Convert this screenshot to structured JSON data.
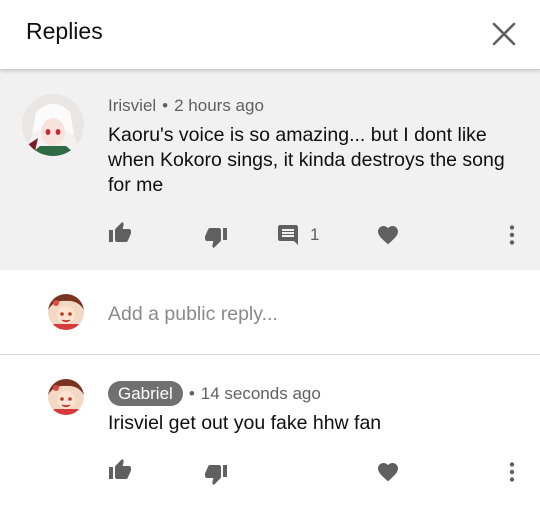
{
  "header": {
    "title": "Replies",
    "close_icon": "close-icon"
  },
  "parent_comment": {
    "author": "Irisviel",
    "separator": "•",
    "time": "2 hours ago",
    "text": "Kaoru's voice is so amazing... but I dont like when Kokoro sings, it kinda destroys the song for me",
    "reply_count": "1",
    "icons": [
      "like-icon",
      "dislike-icon",
      "reply-icon",
      "heart-icon",
      "more-vert-icon"
    ]
  },
  "reply_box": {
    "placeholder": "Add a public reply..."
  },
  "reply_comment": {
    "author": "Gabriel",
    "separator": "•",
    "time": "14 seconds ago",
    "text": "Irisviel get out you fake hhw fan",
    "icons": [
      "like-icon",
      "dislike-icon",
      "heart-icon",
      "more-vert-icon"
    ]
  },
  "colors": {
    "icon": "#606060",
    "parent_bg": "#f1f1f1",
    "chip_bg": "#707070"
  }
}
